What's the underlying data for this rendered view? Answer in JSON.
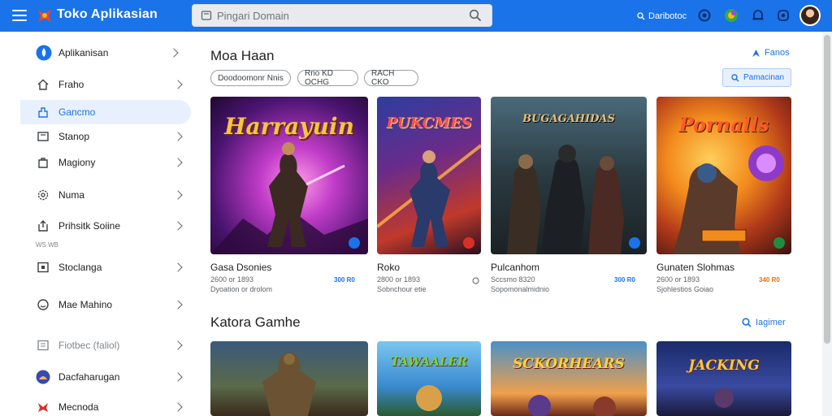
{
  "header": {
    "title": "Toko Aplikasian",
    "search_placeholder": "Pingari Domain",
    "account_label": "Daribotoc",
    "icons": [
      "menu-icon",
      "logo-icon",
      "search-icon",
      "help-icon",
      "games-icon",
      "notification-icon",
      "settings-icon",
      "avatar"
    ]
  },
  "sidebar": {
    "items": [
      {
        "label": "Aplikanisan",
        "icon": "app-icon"
      },
      {
        "label": "Fraho",
        "icon": "home-icon"
      },
      {
        "label": "Gancmo",
        "icon": "game-icon",
        "active": true
      },
      {
        "label": "Stanop",
        "icon": "shop-icon"
      },
      {
        "label": "Magiony",
        "icon": "bag-icon"
      },
      {
        "label": "Numa",
        "icon": "gear-icon"
      },
      {
        "label": "Prihsitk Soiine",
        "icon": "share-icon",
        "sub": "WS WB"
      },
      {
        "label": "Stoclanga",
        "icon": "storage-icon"
      },
      {
        "label": "Mae Mahino",
        "icon": "smile-icon"
      },
      {
        "label": "Fiotbec (faliol)",
        "icon": "list-icon"
      },
      {
        "label": "Dacfaharugan",
        "icon": "globe-icon"
      },
      {
        "label": "Mecnoda",
        "icon": "flag-icon"
      }
    ]
  },
  "section1": {
    "title": "Moa Haan",
    "see_more": "Fanos",
    "chips": [
      "Doodoomonr Nnis",
      "Rno KD OCHG",
      "RACH CKO"
    ],
    "filter_label": "Pamacinan"
  },
  "section2": {
    "title": "Katora Gamhe",
    "see_more": "Iagimer"
  },
  "games_row1": [
    {
      "name": "Gasa Dsonies",
      "meta1": "2600 or 1893",
      "meta2": "Dyoation or drolom",
      "price": "300 R0",
      "art": "Harrayuin",
      "badge_color": "#1a73e8",
      "price_color": "#1a73e8"
    },
    {
      "name": "Roko",
      "meta1": "2800 or 1893",
      "meta2": "Sobnchour etie",
      "price": "",
      "art": "PUKCMES",
      "badge_color": "#d93025",
      "price_color": "#5f6368"
    },
    {
      "name": "Pulcanhom",
      "meta1": "Sccsmo 8320",
      "meta2": "Sopomonalmidnio",
      "price": "300 R0",
      "art": "BUGAGAHIDAS",
      "badge_color": "#1a73e8",
      "price_color": "#1a73e8"
    },
    {
      "name": "Gunaten Slohmas",
      "meta1": "2600 or 1893",
      "meta2": "Sjohlestios Goiao",
      "price": "340 R0",
      "art": "Pornalls",
      "badge_color": "#1e8e3e",
      "price_color": "#e8710a"
    }
  ],
  "games_row2": [
    {
      "art": ""
    },
    {
      "art": "TAWAALER"
    },
    {
      "art": "SCKORHEARS"
    },
    {
      "art": "JACKING"
    }
  ]
}
